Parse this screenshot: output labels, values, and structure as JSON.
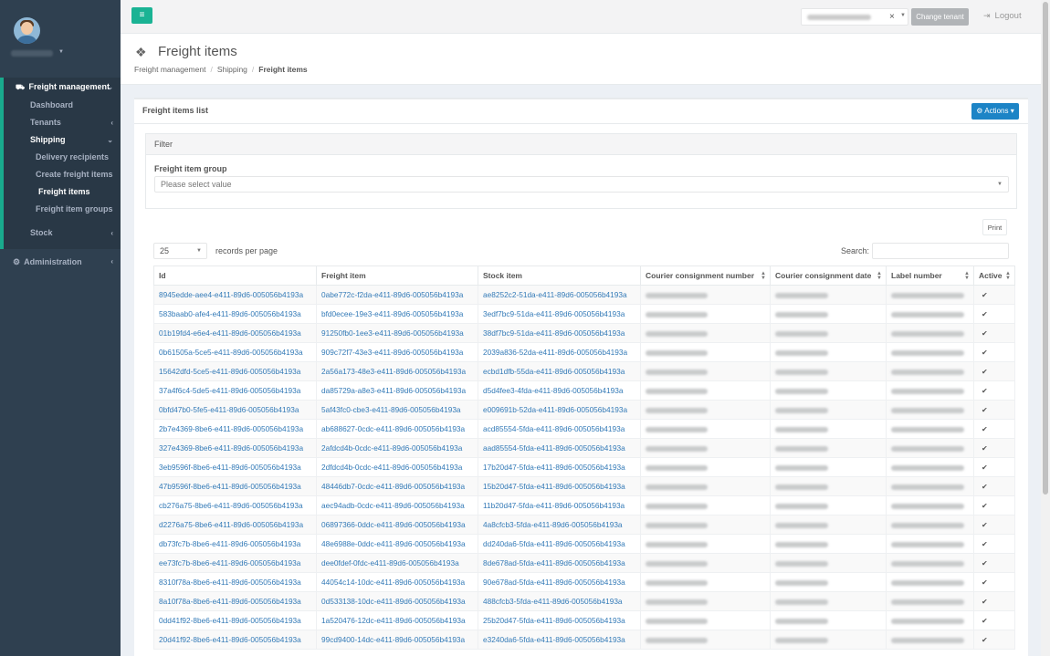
{
  "topbar": {
    "menu_icon": "hamburger-icon",
    "clear_glyph": "×",
    "change_tenant_label": "Change tenant",
    "logout_label": "Logout",
    "accent": "#1ab394"
  },
  "sidebar": {
    "bg": "#2f4050",
    "groups": {
      "freight_management": "Freight management",
      "dashboard": "Dashboard",
      "tenants": "Tenants",
      "shipping": "Shipping",
      "delivery_recipients": "Delivery recipients",
      "create_freight_items": "Create freight items",
      "freight_items": "Freight items",
      "freight_item_groups": "Freight item groups",
      "stock": "Stock",
      "administration": "Administration"
    }
  },
  "page": {
    "title": "Freight items",
    "breadcrumb": [
      "Freight management",
      "Shipping",
      "Freight items"
    ]
  },
  "list": {
    "title": "Freight items list",
    "actions_label": "Actions",
    "filter_title": "Filter",
    "filter_label": "Freight item group",
    "filter_placeholder": "Please select value",
    "print_label": "Print",
    "page_size": "25",
    "records_per_page": "records per page",
    "search_label": "Search:",
    "columns": [
      "Id",
      "Freight item",
      "Stock item",
      "Courier consignment number",
      "Courier consignment date",
      "Label number",
      "Active"
    ],
    "rows": [
      [
        "8945edde-aee4-e411-89d6-005056b4193a",
        "0abe772c-f2da-e411-89d6-005056b4193a",
        "ae8252c2-51da-e411-89d6-005056b4193a"
      ],
      [
        "583baab0-afe4-e411-89d6-005056b4193a",
        "bfd0ecee-19e3-e411-89d6-005056b4193a",
        "3edf7bc9-51da-e411-89d6-005056b4193a"
      ],
      [
        "01b19fd4-e6e4-e411-89d6-005056b4193a",
        "91250fb0-1ee3-e411-89d6-005056b4193a",
        "38df7bc9-51da-e411-89d6-005056b4193a"
      ],
      [
        "0b61505a-5ce5-e411-89d6-005056b4193a",
        "909c72f7-43e3-e411-89d6-005056b4193a",
        "2039a836-52da-e411-89d6-005056b4193a"
      ],
      [
        "15642dfd-5ce5-e411-89d6-005056b4193a",
        "2a56a173-48e3-e411-89d6-005056b4193a",
        "ecbd1dfb-55da-e411-89d6-005056b4193a"
      ],
      [
        "37a4f6c4-5de5-e411-89d6-005056b4193a",
        "da85729a-a8e3-e411-89d6-005056b4193a",
        "d5d4fee3-4fda-e411-89d6-005056b4193a"
      ],
      [
        "0bfd47b0-5fe5-e411-89d6-005056b4193a",
        "5af43fc0-cbe3-e411-89d6-005056b4193a",
        "e009691b-52da-e411-89d6-005056b4193a"
      ],
      [
        "2b7e4369-8be6-e411-89d6-005056b4193a",
        "ab688627-0cdc-e411-89d6-005056b4193a",
        "acd85554-5fda-e411-89d6-005056b4193a"
      ],
      [
        "327e4369-8be6-e411-89d6-005056b4193a",
        "2afdcd4b-0cdc-e411-89d6-005056b4193a",
        "aad85554-5fda-e411-89d6-005056b4193a"
      ],
      [
        "3eb9596f-8be6-e411-89d6-005056b4193a",
        "2dfdcd4b-0cdc-e411-89d6-005056b4193a",
        "17b20d47-5fda-e411-89d6-005056b4193a"
      ],
      [
        "47b9596f-8be6-e411-89d6-005056b4193a",
        "48446db7-0cdc-e411-89d6-005056b4193a",
        "15b20d47-5fda-e411-89d6-005056b4193a"
      ],
      [
        "cb276a75-8be6-e411-89d6-005056b4193a",
        "aec94adb-0cdc-e411-89d6-005056b4193a",
        "11b20d47-5fda-e411-89d6-005056b4193a"
      ],
      [
        "d2276a75-8be6-e411-89d6-005056b4193a",
        "06897366-0ddc-e411-89d6-005056b4193a",
        "4a8cfcb3-5fda-e411-89d6-005056b4193a"
      ],
      [
        "db73fc7b-8be6-e411-89d6-005056b4193a",
        "48e6988e-0ddc-e411-89d6-005056b4193a",
        "dd240da6-5fda-e411-89d6-005056b4193a"
      ],
      [
        "ee73fc7b-8be6-e411-89d6-005056b4193a",
        "dee0fdef-0fdc-e411-89d6-005056b4193a",
        "8de678ad-5fda-e411-89d6-005056b4193a"
      ],
      [
        "8310f78a-8be6-e411-89d6-005056b4193a",
        "44054c14-10dc-e411-89d6-005056b4193a",
        "90e678ad-5fda-e411-89d6-005056b4193a"
      ],
      [
        "8a10f78a-8be6-e411-89d6-005056b4193a",
        "0d533138-10dc-e411-89d6-005056b4193a",
        "488cfcb3-5fda-e411-89d6-005056b4193a"
      ],
      [
        "0dd41f92-8be6-e411-89d6-005056b4193a",
        "1a520476-12dc-e411-89d6-005056b4193a",
        "25b20d47-5fda-e411-89d6-005056b4193a"
      ],
      [
        "20d41f92-8be6-e411-89d6-005056b4193a",
        "99cd9400-14dc-e411-89d6-005056b4193a",
        "e3240da6-5fda-e411-89d6-005056b4193a"
      ]
    ],
    "active_glyph": "✔"
  }
}
